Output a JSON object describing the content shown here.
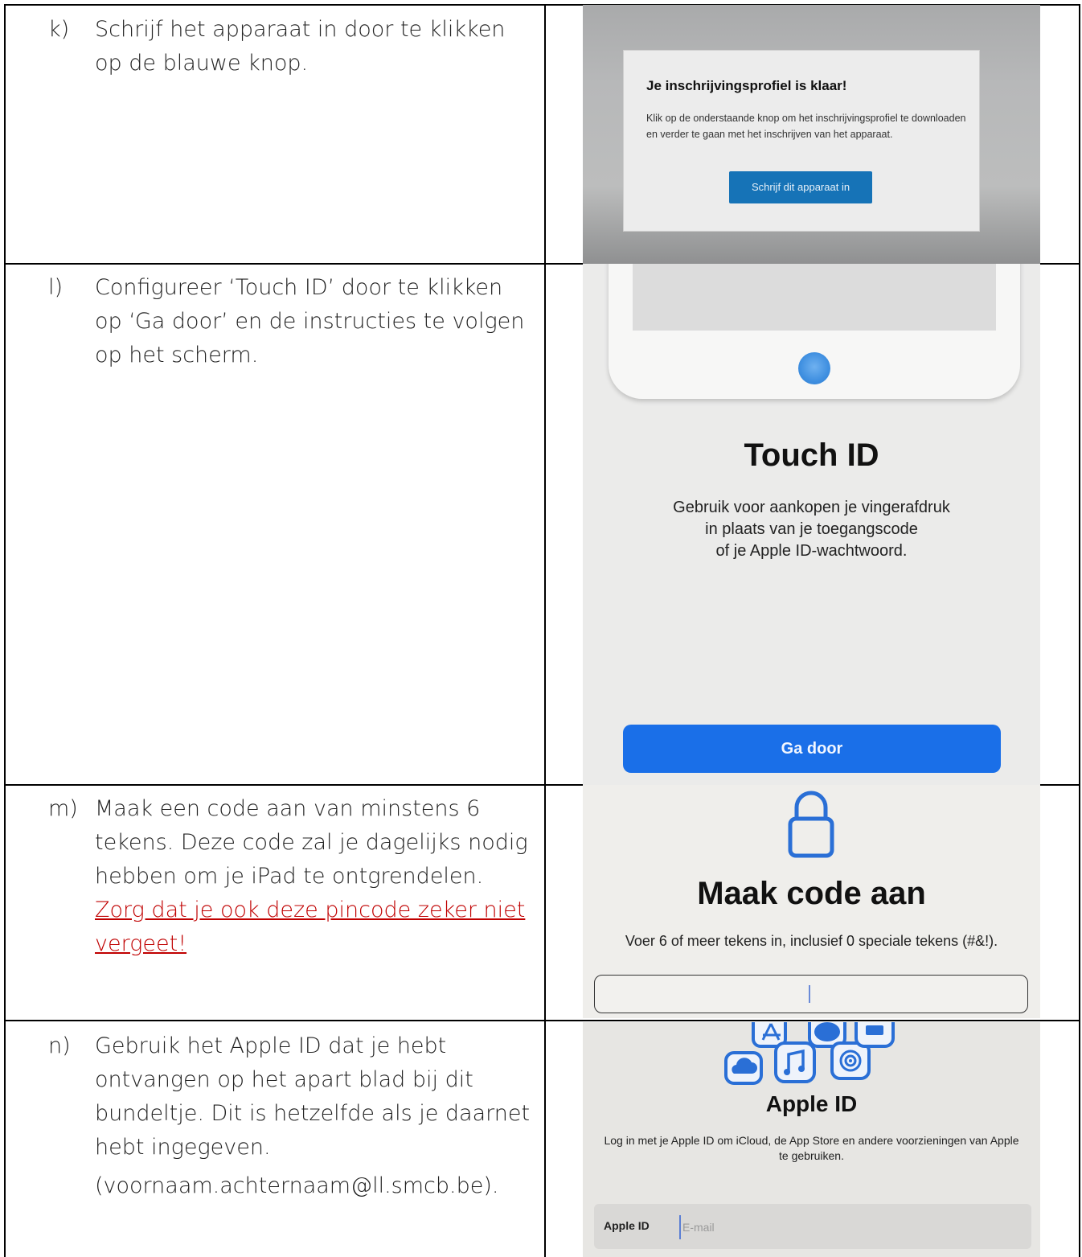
{
  "rows": [
    {
      "marker": "k)",
      "text": "Schrijf het apparaat in door te klikken op de blauwe knop.",
      "screen": {
        "title": "Je inschrijvingsprofiel is klaar!",
        "body": "Klik op de onderstaande knop om het inschrijvingsprofiel te downloaden en verder te gaan met het inschrijven van het apparaat.",
        "button": "Schrijf dit apparaat in",
        "button_color": "#1673b7"
      }
    },
    {
      "marker": "l)",
      "text": "Configureer ‘Touch ID’ door te klikken op ‘Ga door’ en de instructies te volgen op het scherm.",
      "screen": {
        "title": "Touch ID",
        "description_lines": [
          "Gebruik voor aankopen je vingerafdruk",
          "in plaats van je toegangscode",
          "of je Apple ID-wachtwoord."
        ],
        "button": "Ga door",
        "button_color": "#1a6fe8",
        "icons": [
          "home-button"
        ]
      }
    },
    {
      "marker": "m)",
      "text": "Maak een code aan van minstens 6 tekens. Deze code zal je dagelijks nodig hebben om je iPad te ontgrendelen. ",
      "emphasis": "Zorg dat je ook deze pincode zeker niet vergeet!",
      "emphasis_color": "#c00000",
      "screen": {
        "title": "Maak code aan",
        "description": "Voer 6 of meer tekens in, inclusief 0 speciale tekens (#&!).",
        "icons": [
          "lock-icon"
        ]
      }
    },
    {
      "marker": "n)",
      "text": "Gebruik het Apple ID dat je hebt ontvangen op het apart blad bij dit bundeltje. Dit is hetzelfde als je daarnet hebt ingegeven.",
      "example": "(voornaam.achternaam@ll.smcb.be).",
      "screen": {
        "title": "Apple ID",
        "description": "Log in met je Apple ID om iCloud, de App Store en andere voorzieningen van Apple te gebruiken.",
        "field_label": "Apple ID",
        "field_placeholder": "E-mail",
        "icons": [
          "cloud-icon",
          "app-store-icon",
          "music-icon",
          "message-icon",
          "find-my-icon",
          "wallet-icon"
        ]
      }
    }
  ]
}
